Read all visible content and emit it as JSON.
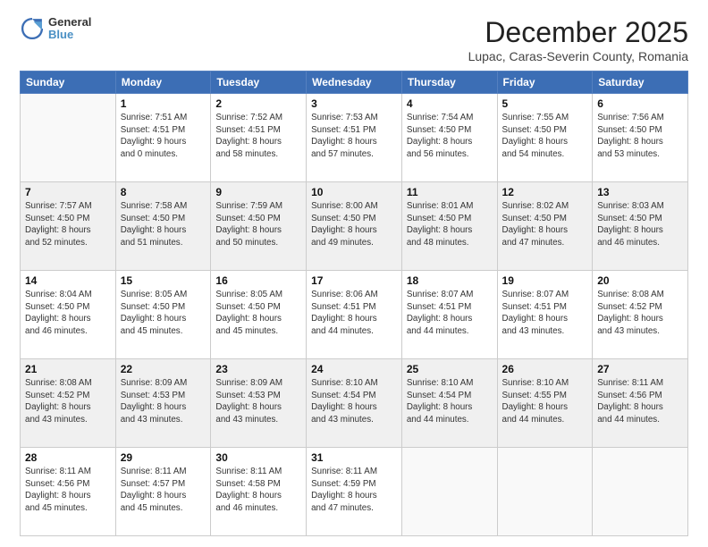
{
  "header": {
    "logo_line1": "General",
    "logo_line2": "Blue",
    "title": "December 2025",
    "subtitle": "Lupac, Caras-Severin County, Romania"
  },
  "weekdays": [
    "Sunday",
    "Monday",
    "Tuesday",
    "Wednesday",
    "Thursday",
    "Friday",
    "Saturday"
  ],
  "weeks": [
    [
      {
        "day": "",
        "info": ""
      },
      {
        "day": "1",
        "info": "Sunrise: 7:51 AM\nSunset: 4:51 PM\nDaylight: 9 hours\nand 0 minutes."
      },
      {
        "day": "2",
        "info": "Sunrise: 7:52 AM\nSunset: 4:51 PM\nDaylight: 8 hours\nand 58 minutes."
      },
      {
        "day": "3",
        "info": "Sunrise: 7:53 AM\nSunset: 4:51 PM\nDaylight: 8 hours\nand 57 minutes."
      },
      {
        "day": "4",
        "info": "Sunrise: 7:54 AM\nSunset: 4:50 PM\nDaylight: 8 hours\nand 56 minutes."
      },
      {
        "day": "5",
        "info": "Sunrise: 7:55 AM\nSunset: 4:50 PM\nDaylight: 8 hours\nand 54 minutes."
      },
      {
        "day": "6",
        "info": "Sunrise: 7:56 AM\nSunset: 4:50 PM\nDaylight: 8 hours\nand 53 minutes."
      }
    ],
    [
      {
        "day": "7",
        "info": "Sunrise: 7:57 AM\nSunset: 4:50 PM\nDaylight: 8 hours\nand 52 minutes."
      },
      {
        "day": "8",
        "info": "Sunrise: 7:58 AM\nSunset: 4:50 PM\nDaylight: 8 hours\nand 51 minutes."
      },
      {
        "day": "9",
        "info": "Sunrise: 7:59 AM\nSunset: 4:50 PM\nDaylight: 8 hours\nand 50 minutes."
      },
      {
        "day": "10",
        "info": "Sunrise: 8:00 AM\nSunset: 4:50 PM\nDaylight: 8 hours\nand 49 minutes."
      },
      {
        "day": "11",
        "info": "Sunrise: 8:01 AM\nSunset: 4:50 PM\nDaylight: 8 hours\nand 48 minutes."
      },
      {
        "day": "12",
        "info": "Sunrise: 8:02 AM\nSunset: 4:50 PM\nDaylight: 8 hours\nand 47 minutes."
      },
      {
        "day": "13",
        "info": "Sunrise: 8:03 AM\nSunset: 4:50 PM\nDaylight: 8 hours\nand 46 minutes."
      }
    ],
    [
      {
        "day": "14",
        "info": "Sunrise: 8:04 AM\nSunset: 4:50 PM\nDaylight: 8 hours\nand 46 minutes."
      },
      {
        "day": "15",
        "info": "Sunrise: 8:05 AM\nSunset: 4:50 PM\nDaylight: 8 hours\nand 45 minutes."
      },
      {
        "day": "16",
        "info": "Sunrise: 8:05 AM\nSunset: 4:50 PM\nDaylight: 8 hours\nand 45 minutes."
      },
      {
        "day": "17",
        "info": "Sunrise: 8:06 AM\nSunset: 4:51 PM\nDaylight: 8 hours\nand 44 minutes."
      },
      {
        "day": "18",
        "info": "Sunrise: 8:07 AM\nSunset: 4:51 PM\nDaylight: 8 hours\nand 44 minutes."
      },
      {
        "day": "19",
        "info": "Sunrise: 8:07 AM\nSunset: 4:51 PM\nDaylight: 8 hours\nand 43 minutes."
      },
      {
        "day": "20",
        "info": "Sunrise: 8:08 AM\nSunset: 4:52 PM\nDaylight: 8 hours\nand 43 minutes."
      }
    ],
    [
      {
        "day": "21",
        "info": "Sunrise: 8:08 AM\nSunset: 4:52 PM\nDaylight: 8 hours\nand 43 minutes."
      },
      {
        "day": "22",
        "info": "Sunrise: 8:09 AM\nSunset: 4:53 PM\nDaylight: 8 hours\nand 43 minutes."
      },
      {
        "day": "23",
        "info": "Sunrise: 8:09 AM\nSunset: 4:53 PM\nDaylight: 8 hours\nand 43 minutes."
      },
      {
        "day": "24",
        "info": "Sunrise: 8:10 AM\nSunset: 4:54 PM\nDaylight: 8 hours\nand 43 minutes."
      },
      {
        "day": "25",
        "info": "Sunrise: 8:10 AM\nSunset: 4:54 PM\nDaylight: 8 hours\nand 44 minutes."
      },
      {
        "day": "26",
        "info": "Sunrise: 8:10 AM\nSunset: 4:55 PM\nDaylight: 8 hours\nand 44 minutes."
      },
      {
        "day": "27",
        "info": "Sunrise: 8:11 AM\nSunset: 4:56 PM\nDaylight: 8 hours\nand 44 minutes."
      }
    ],
    [
      {
        "day": "28",
        "info": "Sunrise: 8:11 AM\nSunset: 4:56 PM\nDaylight: 8 hours\nand 45 minutes."
      },
      {
        "day": "29",
        "info": "Sunrise: 8:11 AM\nSunset: 4:57 PM\nDaylight: 8 hours\nand 45 minutes."
      },
      {
        "day": "30",
        "info": "Sunrise: 8:11 AM\nSunset: 4:58 PM\nDaylight: 8 hours\nand 46 minutes."
      },
      {
        "day": "31",
        "info": "Sunrise: 8:11 AM\nSunset: 4:59 PM\nDaylight: 8 hours\nand 47 minutes."
      },
      {
        "day": "",
        "info": ""
      },
      {
        "day": "",
        "info": ""
      },
      {
        "day": "",
        "info": ""
      }
    ]
  ]
}
